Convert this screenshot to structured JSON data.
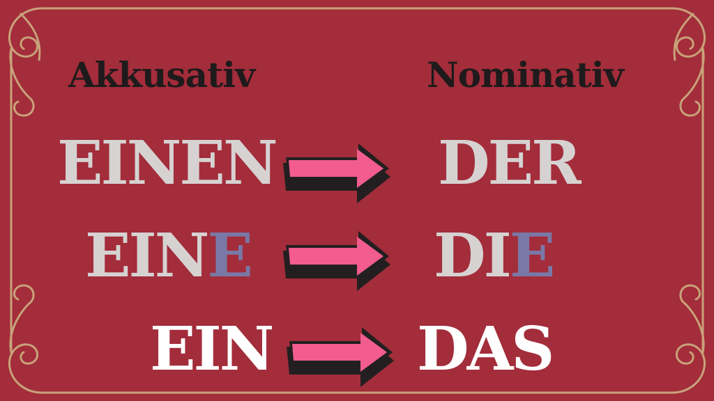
{
  "headings": {
    "accusative": "Akkusativ",
    "nominative": "Nominativ"
  },
  "rows": [
    {
      "accusative": {
        "base": "EINEN",
        "highlight": ""
      },
      "nominative": {
        "base": "DER",
        "highlight": ""
      }
    },
    {
      "accusative": {
        "base": "EIN",
        "highlight": "E"
      },
      "nominative": {
        "base": "DI",
        "highlight": "E"
      }
    },
    {
      "accusative": {
        "base": "EIN",
        "highlight": ""
      },
      "nominative": {
        "base": "DAS",
        "highlight": ""
      }
    }
  ],
  "colors": {
    "background": "#a32d3a",
    "frame": "#c9a27a",
    "heading": "#1f1a1c",
    "word_gray": "#d6d2d2",
    "word_white": "#ffffff",
    "highlight": "#7a78a6",
    "arrow_fill": "#f25c8e",
    "arrow_shadow": "#231f20"
  }
}
